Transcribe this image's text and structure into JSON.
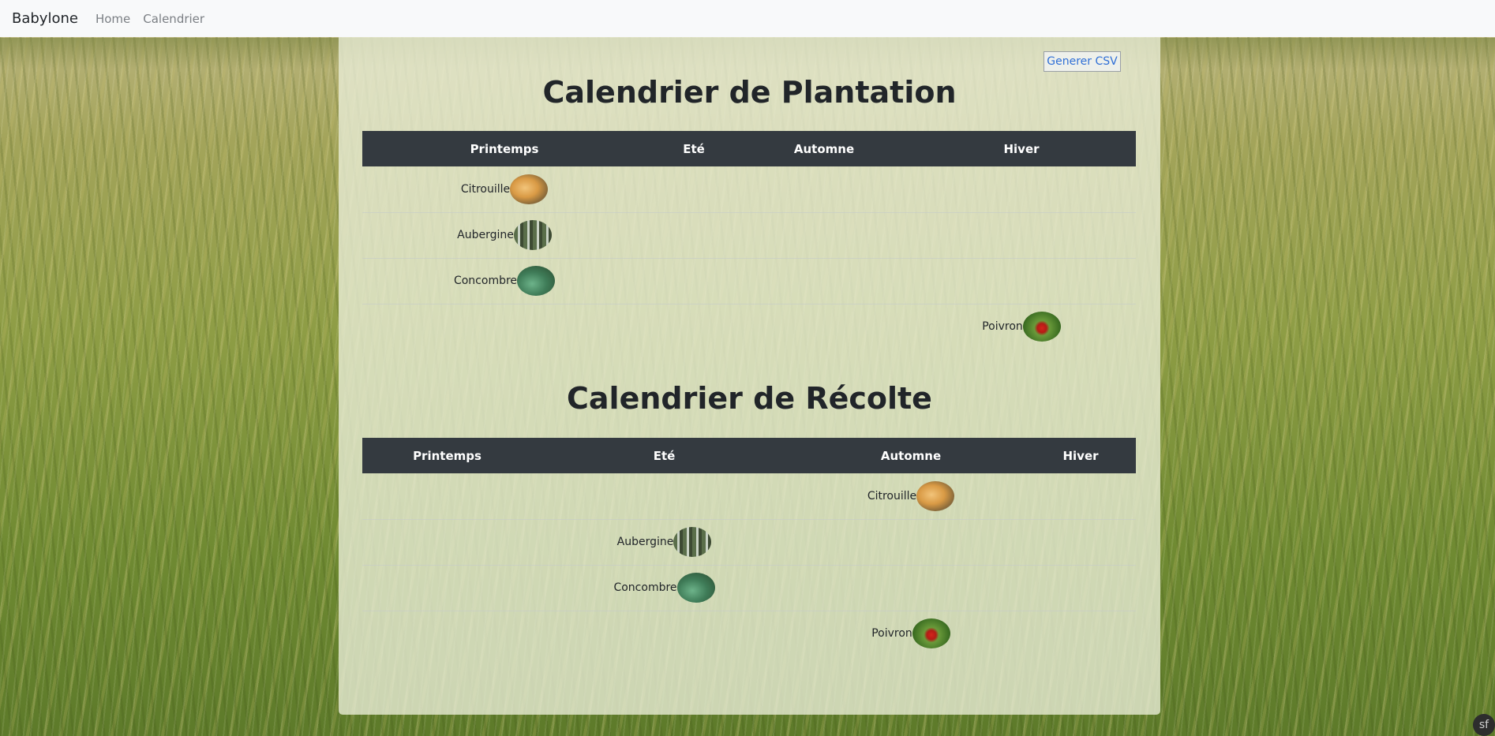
{
  "navbar": {
    "brand": "Babylone",
    "links": [
      "Home",
      "Calendrier"
    ]
  },
  "actions": {
    "csv_label": "Generer CSV"
  },
  "plantation": {
    "title": "Calendrier de Plantation",
    "headers": [
      "Printemps",
      "Eté",
      "Automne",
      "Hiver"
    ],
    "rows": [
      [
        "Citrouille",
        "",
        "",
        ""
      ],
      [
        "Aubergine",
        "",
        "",
        ""
      ],
      [
        "Concombre",
        "",
        "",
        ""
      ],
      [
        "",
        "",
        "",
        "Poivron"
      ]
    ]
  },
  "recolte": {
    "title": "Calendrier de Récolte",
    "headers": [
      "Printemps",
      "Eté",
      "Automne",
      "Hiver"
    ],
    "rows": [
      [
        "",
        "",
        "Citrouille",
        ""
      ],
      [
        "",
        "Aubergine",
        "",
        ""
      ],
      [
        "",
        "Concombre",
        "",
        ""
      ],
      [
        "",
        "",
        "Poivron",
        ""
      ]
    ]
  },
  "images": {
    "Citrouille": "img-citrouille",
    "Aubergine": "img-aubergine",
    "Concombre": "img-concombre",
    "Poivron": "img-poivron"
  },
  "debug_badge": "sf"
}
